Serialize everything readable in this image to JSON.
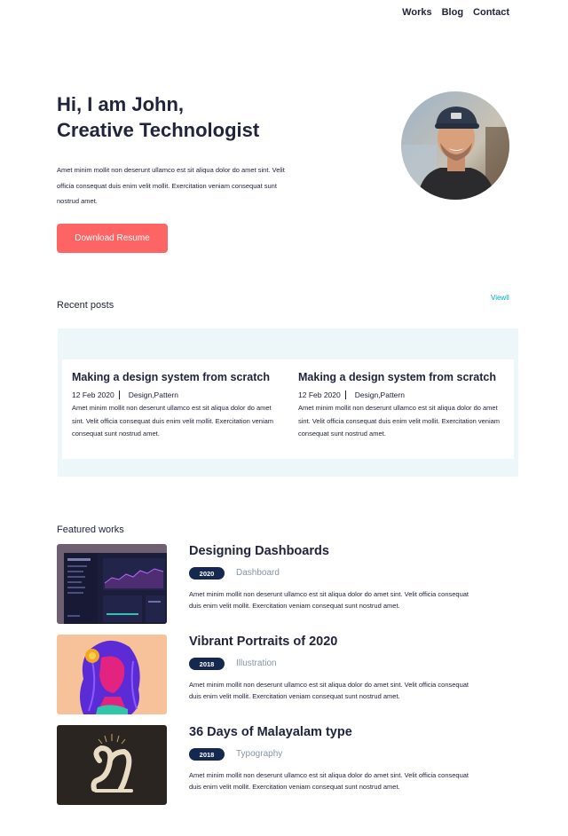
{
  "nav": {
    "items": [
      "Works",
      "Blog",
      "Contact"
    ]
  },
  "hero": {
    "title_line1": "Hi, I am John,",
    "title_line2": "Creative Technologist",
    "description": "Amet minim mollit non deserunt ullamco est sit aliqua dolor do amet sint. Velit officia consequat duis enim velit mollit. Exercitation veniam consequat sunt nostrud amet.",
    "button_label": "Download Resume"
  },
  "recent_posts": {
    "heading": "Recent posts",
    "view_all": "Viewll",
    "posts": [
      {
        "title": "Making a design system from scratch",
        "date": "12 Feb 2020",
        "tags": "Design,Pattern",
        "excerpt": "Amet minim mollit non deserunt ullamco est sit aliqua dolor do amet sint. Velit officia consequat duis enim velit mollit. Exercitation veniam consequat sunt nostrud amet."
      },
      {
        "title": "Making a design system from scratch",
        "date": "12 Feb 2020",
        "tags": "Design,Pattern",
        "excerpt": "Amet minim mollit non deserunt ullamco est sit aliqua dolor do amet sint. Velit officia consequat duis enim velit mollit. Exercitation veniam consequat sunt nostrud amet."
      }
    ]
  },
  "featured_works": {
    "heading": "Featured works",
    "items": [
      {
        "title": "Designing Dashboards",
        "year": "2020",
        "category": "Dashboard",
        "description": "Amet minim mollit non deserunt ullamco est sit aliqua dolor do amet sint. Velit officia consequat duis enim velit mollit. Exercitation veniam consequat sunt nostrud amet."
      },
      {
        "title": "Vibrant Portraits of 2020",
        "year": "2018",
        "category": "Illustration",
        "description": "Amet minim mollit non deserunt ullamco est sit aliqua dolor do amet sint. Velit officia consequat duis enim velit mollit. Exercitation veniam consequat sunt nostrud amet."
      },
      {
        "title": "36 Days of Malayalam type",
        "year": "2018",
        "category": "Typography",
        "description": "Amet minim mollit non deserunt ullamco est sit aliqua dolor do amet sint. Velit officia consequat duis enim velit mollit. Exercitation veniam consequat sunt nostrud amet."
      }
    ]
  },
  "colors": {
    "accent": "#ff6464",
    "text": "#21243d",
    "link": "#00a8cc",
    "badge": "#142850",
    "muted": "#8695a4",
    "panel": "#edf7fa"
  }
}
